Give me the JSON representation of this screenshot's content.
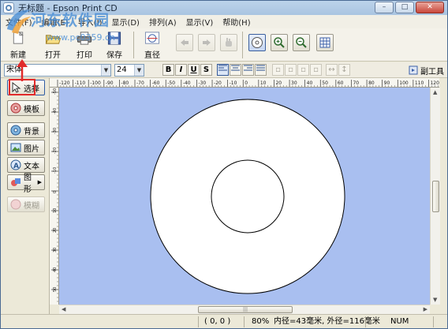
{
  "window": {
    "title": "无标题 - Epson Print CD",
    "buttons": [
      "minimize",
      "maximize",
      "close"
    ]
  },
  "menu": [
    "文件(F)",
    "编辑(E)",
    "导入(I)",
    "显示(D)",
    "排列(A)",
    "显示(V)",
    "帮助(H)"
  ],
  "watermark": {
    "title": "河东软件园",
    "url": "www.pc0359.cn"
  },
  "toolbar": {
    "buttons": [
      {
        "label": "新建",
        "icon": "new-doc-icon"
      },
      {
        "label": "打开",
        "icon": "open-folder-icon"
      },
      {
        "label": "打印",
        "icon": "printer-icon"
      },
      {
        "label": "保存",
        "icon": "save-disk-icon"
      },
      {
        "label": "直径",
        "icon": "diameter-icon"
      }
    ],
    "tools": [
      "undo-icon",
      "redo-icon",
      "hand-icon",
      "disc-view-icon",
      "zoom-in-icon",
      "zoom-out-icon",
      "grid-icon"
    ]
  },
  "format": {
    "font": "宋体",
    "size": "24",
    "style_buttons": [
      "B",
      "I",
      "U",
      "S"
    ],
    "sub_tool_label": "副工具"
  },
  "sidebar": {
    "items": [
      {
        "label": "选择",
        "icon": "pointer-icon"
      },
      {
        "label": "模板",
        "icon": "template-icon"
      },
      {
        "label": "背景",
        "icon": "background-icon"
      },
      {
        "label": "图片",
        "icon": "picture-icon"
      },
      {
        "label": "文本",
        "icon": "text-icon"
      },
      {
        "label": "图形",
        "icon": "shape-icon"
      },
      {
        "label": "模糊",
        "icon": "blur-icon"
      }
    ]
  },
  "ruler": {
    "top_labels": [
      "-120",
      "-110",
      "-100",
      "-90",
      "-80",
      "-70",
      "-60",
      "-50",
      "-40",
      "-30",
      "-20",
      "-10",
      "0",
      "10",
      "20",
      "30",
      "40",
      "50",
      "60",
      "70",
      "80",
      "90",
      "100",
      "110",
      "120"
    ],
    "left_labels": [
      "-50",
      "-40",
      "-30",
      "-20",
      "-10",
      "0",
      "10",
      "20",
      "30",
      "40",
      "50"
    ]
  },
  "status": {
    "coords": "(    0,    0 )",
    "zoom": "80%",
    "disc_info": "内径=43毫米, 外径=116毫米",
    "num": "NUM"
  },
  "colors": {
    "canvas": "#a9bff0",
    "annotation": "#e12b2b",
    "watermark": "#4b8fd6"
  }
}
